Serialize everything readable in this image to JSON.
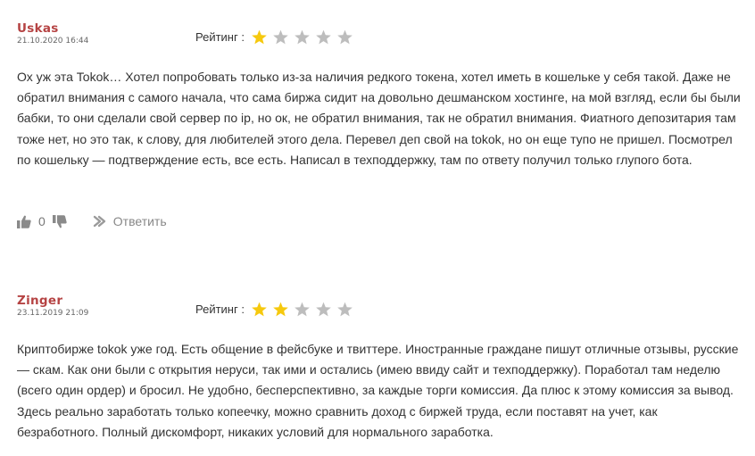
{
  "star_colors": {
    "filled": "#f6c90e",
    "empty": "#bdbdbd"
  },
  "rating_label": "Рейтинг :",
  "reviews": [
    {
      "author": "Uskas",
      "date": "21.10.2020 16:44",
      "rating": 1,
      "max_rating": 5,
      "text": "Ох уж эта Tokok… Хотел попробовать только из-за наличия редкого токена, хотел иметь в кошельке у себя такой. Даже не обратил внимания с самого начала, что сама биржа сидит на довольно дешманском хостинге, на мой взгляд, если бы были бабки, то они сделали свой сервер по ip, но ок, не обратил внимания, так не обратил внимания. Фиатного депозитария там тоже нет, но это так, к слову, для любителей этого дела. Перевел деп свой на tokok, но он еще тупо не пришел. Посмотрел по кошельку — подтверждение есть, все есть. Написал в техподдержку, там по ответу получил только глупого бота.",
      "likes": "0",
      "reply_label": "Ответить",
      "icons": {
        "like": "thumbs-up-icon",
        "dislike": "thumbs-down-icon",
        "reply": "reply-arrow-icon"
      }
    },
    {
      "author": "Zinger",
      "date": "23.11.2019 21:09",
      "rating": 2,
      "max_rating": 5,
      "text": "Криптобирже tokok уже год. Есть общение в фейсбуке и твиттере. Иностранные граждане пишут отличные отзывы, русские — скам. Как они были с открытия неруси, так ими и остались (имею ввиду сайт и техподдержку). Поработал там неделю (всего один ордер) и бросил. Не удобно, бесперспективно, за каждые торги комиссия. Да плюс к этому комиссия за вывод. Здесь реально заработать только копеечку, можно сравнить доход с биржей труда, если поставят на учет, как безработного. Полный дискомфорт, никаких условий для нормального заработка."
    }
  ]
}
